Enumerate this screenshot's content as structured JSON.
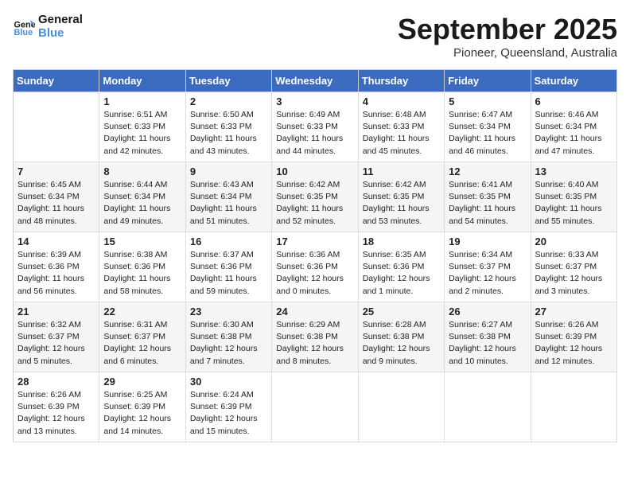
{
  "header": {
    "logo_line1": "General",
    "logo_line2": "Blue",
    "month": "September 2025",
    "location": "Pioneer, Queensland, Australia"
  },
  "days_of_week": [
    "Sunday",
    "Monday",
    "Tuesday",
    "Wednesday",
    "Thursday",
    "Friday",
    "Saturday"
  ],
  "weeks": [
    [
      {
        "day": "",
        "info": ""
      },
      {
        "day": "1",
        "info": "Sunrise: 6:51 AM\nSunset: 6:33 PM\nDaylight: 11 hours\nand 42 minutes."
      },
      {
        "day": "2",
        "info": "Sunrise: 6:50 AM\nSunset: 6:33 PM\nDaylight: 11 hours\nand 43 minutes."
      },
      {
        "day": "3",
        "info": "Sunrise: 6:49 AM\nSunset: 6:33 PM\nDaylight: 11 hours\nand 44 minutes."
      },
      {
        "day": "4",
        "info": "Sunrise: 6:48 AM\nSunset: 6:33 PM\nDaylight: 11 hours\nand 45 minutes."
      },
      {
        "day": "5",
        "info": "Sunrise: 6:47 AM\nSunset: 6:34 PM\nDaylight: 11 hours\nand 46 minutes."
      },
      {
        "day": "6",
        "info": "Sunrise: 6:46 AM\nSunset: 6:34 PM\nDaylight: 11 hours\nand 47 minutes."
      }
    ],
    [
      {
        "day": "7",
        "info": "Sunrise: 6:45 AM\nSunset: 6:34 PM\nDaylight: 11 hours\nand 48 minutes."
      },
      {
        "day": "8",
        "info": "Sunrise: 6:44 AM\nSunset: 6:34 PM\nDaylight: 11 hours\nand 49 minutes."
      },
      {
        "day": "9",
        "info": "Sunrise: 6:43 AM\nSunset: 6:34 PM\nDaylight: 11 hours\nand 51 minutes."
      },
      {
        "day": "10",
        "info": "Sunrise: 6:42 AM\nSunset: 6:35 PM\nDaylight: 11 hours\nand 52 minutes."
      },
      {
        "day": "11",
        "info": "Sunrise: 6:42 AM\nSunset: 6:35 PM\nDaylight: 11 hours\nand 53 minutes."
      },
      {
        "day": "12",
        "info": "Sunrise: 6:41 AM\nSunset: 6:35 PM\nDaylight: 11 hours\nand 54 minutes."
      },
      {
        "day": "13",
        "info": "Sunrise: 6:40 AM\nSunset: 6:35 PM\nDaylight: 11 hours\nand 55 minutes."
      }
    ],
    [
      {
        "day": "14",
        "info": "Sunrise: 6:39 AM\nSunset: 6:36 PM\nDaylight: 11 hours\nand 56 minutes."
      },
      {
        "day": "15",
        "info": "Sunrise: 6:38 AM\nSunset: 6:36 PM\nDaylight: 11 hours\nand 58 minutes."
      },
      {
        "day": "16",
        "info": "Sunrise: 6:37 AM\nSunset: 6:36 PM\nDaylight: 11 hours\nand 59 minutes."
      },
      {
        "day": "17",
        "info": "Sunrise: 6:36 AM\nSunset: 6:36 PM\nDaylight: 12 hours\nand 0 minutes."
      },
      {
        "day": "18",
        "info": "Sunrise: 6:35 AM\nSunset: 6:36 PM\nDaylight: 12 hours\nand 1 minute."
      },
      {
        "day": "19",
        "info": "Sunrise: 6:34 AM\nSunset: 6:37 PM\nDaylight: 12 hours\nand 2 minutes."
      },
      {
        "day": "20",
        "info": "Sunrise: 6:33 AM\nSunset: 6:37 PM\nDaylight: 12 hours\nand 3 minutes."
      }
    ],
    [
      {
        "day": "21",
        "info": "Sunrise: 6:32 AM\nSunset: 6:37 PM\nDaylight: 12 hours\nand 5 minutes."
      },
      {
        "day": "22",
        "info": "Sunrise: 6:31 AM\nSunset: 6:37 PM\nDaylight: 12 hours\nand 6 minutes."
      },
      {
        "day": "23",
        "info": "Sunrise: 6:30 AM\nSunset: 6:38 PM\nDaylight: 12 hours\nand 7 minutes."
      },
      {
        "day": "24",
        "info": "Sunrise: 6:29 AM\nSunset: 6:38 PM\nDaylight: 12 hours\nand 8 minutes."
      },
      {
        "day": "25",
        "info": "Sunrise: 6:28 AM\nSunset: 6:38 PM\nDaylight: 12 hours\nand 9 minutes."
      },
      {
        "day": "26",
        "info": "Sunrise: 6:27 AM\nSunset: 6:38 PM\nDaylight: 12 hours\nand 10 minutes."
      },
      {
        "day": "27",
        "info": "Sunrise: 6:26 AM\nSunset: 6:39 PM\nDaylight: 12 hours\nand 12 minutes."
      }
    ],
    [
      {
        "day": "28",
        "info": "Sunrise: 6:26 AM\nSunset: 6:39 PM\nDaylight: 12 hours\nand 13 minutes."
      },
      {
        "day": "29",
        "info": "Sunrise: 6:25 AM\nSunset: 6:39 PM\nDaylight: 12 hours\nand 14 minutes."
      },
      {
        "day": "30",
        "info": "Sunrise: 6:24 AM\nSunset: 6:39 PM\nDaylight: 12 hours\nand 15 minutes."
      },
      {
        "day": "",
        "info": ""
      },
      {
        "day": "",
        "info": ""
      },
      {
        "day": "",
        "info": ""
      },
      {
        "day": "",
        "info": ""
      }
    ]
  ]
}
